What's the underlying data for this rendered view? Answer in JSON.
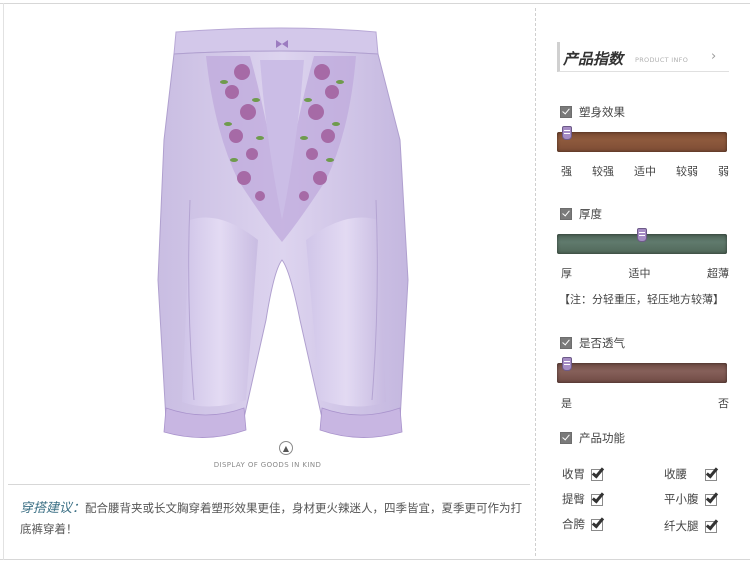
{
  "photo": {
    "caption": "DISPLAY OF GOODS IN KIND",
    "up_icon": "chevron-up-icon",
    "colors": {
      "fabric": "#cfc3e6",
      "lace": "#b69bd3",
      "flower": "#a86aa6",
      "leaf": "#6f9b4d"
    }
  },
  "suggestion": {
    "title": "穿搭建议：",
    "text": "配合腰背夹或长文胸穿着塑形效果更佳，身材更火辣迷人，四季皆宜，夏季更可作为打底裤穿着！"
  },
  "panel": {
    "title": "产品指数",
    "subtitle": "PRODUCT INFO",
    "arrow_icon": "chevron-right-icon",
    "shaping": {
      "label": "塑身效果",
      "scale": [
        "强",
        "较强",
        "适中",
        "较弱",
        "弱"
      ],
      "level": 0.06,
      "bar_color": "#8e5a3d"
    },
    "thickness": {
      "label": "厚度",
      "scale": [
        "厚",
        "适中",
        "超薄"
      ],
      "level": 0.5,
      "note": "【注：分轻重压，轻压地方较薄】",
      "bar_color": "#607a6d"
    },
    "breathable": {
      "label": "是否透气",
      "scale": [
        "是",
        "否"
      ],
      "level": 0.06,
      "bar_color": "#86605a"
    },
    "functions": {
      "label": "产品功能",
      "items": [
        {
          "label": "收胃",
          "checked": true
        },
        {
          "label": "收腰",
          "checked": true
        },
        {
          "label": "提臀",
          "checked": true
        },
        {
          "label": "平小腹",
          "checked": true
        },
        {
          "label": "合胯",
          "checked": true
        },
        {
          "label": "纤大腿",
          "checked": true
        }
      ]
    }
  }
}
